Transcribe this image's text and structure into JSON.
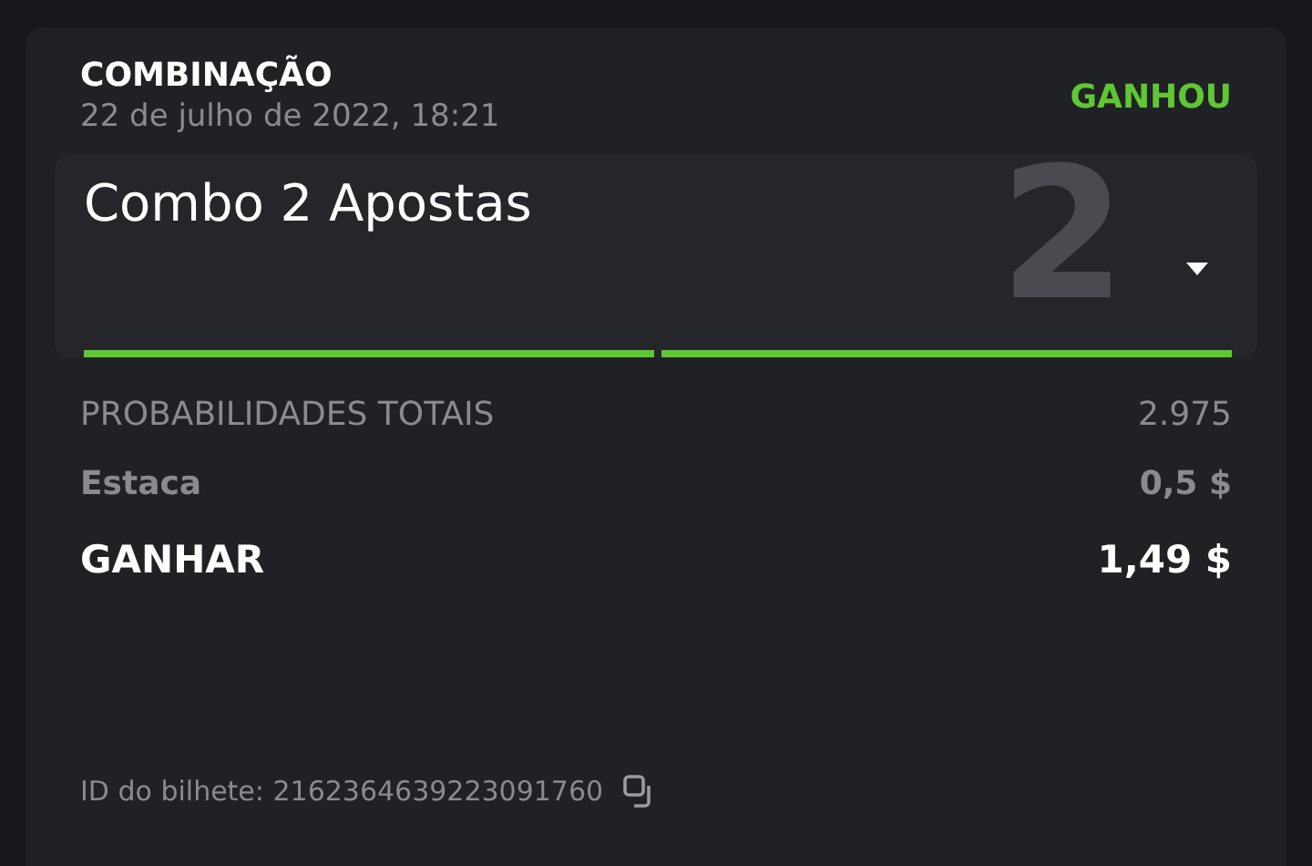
{
  "bet": {
    "type": "COMBINAÇÃO",
    "date": "22 de julho de 2022, 18:21",
    "status": {
      "label": "GANHOU",
      "kind": "won"
    }
  },
  "combo": {
    "title": "Combo 2 Apostas",
    "count": "2",
    "expanded": false,
    "legs": [
      {
        "won": true
      },
      {
        "won": true
      }
    ]
  },
  "summary": [
    {
      "kind": "odds",
      "label": "PROBABILIDADES TOTAIS",
      "value": "2.975"
    },
    {
      "kind": "stake",
      "label": "Estaca",
      "value": "0,5 $"
    },
    {
      "kind": "win",
      "label": "GANHAR",
      "value": "1,49 $"
    }
  ],
  "ticket_id": "ID do bilhete: 2162364639223091760"
}
